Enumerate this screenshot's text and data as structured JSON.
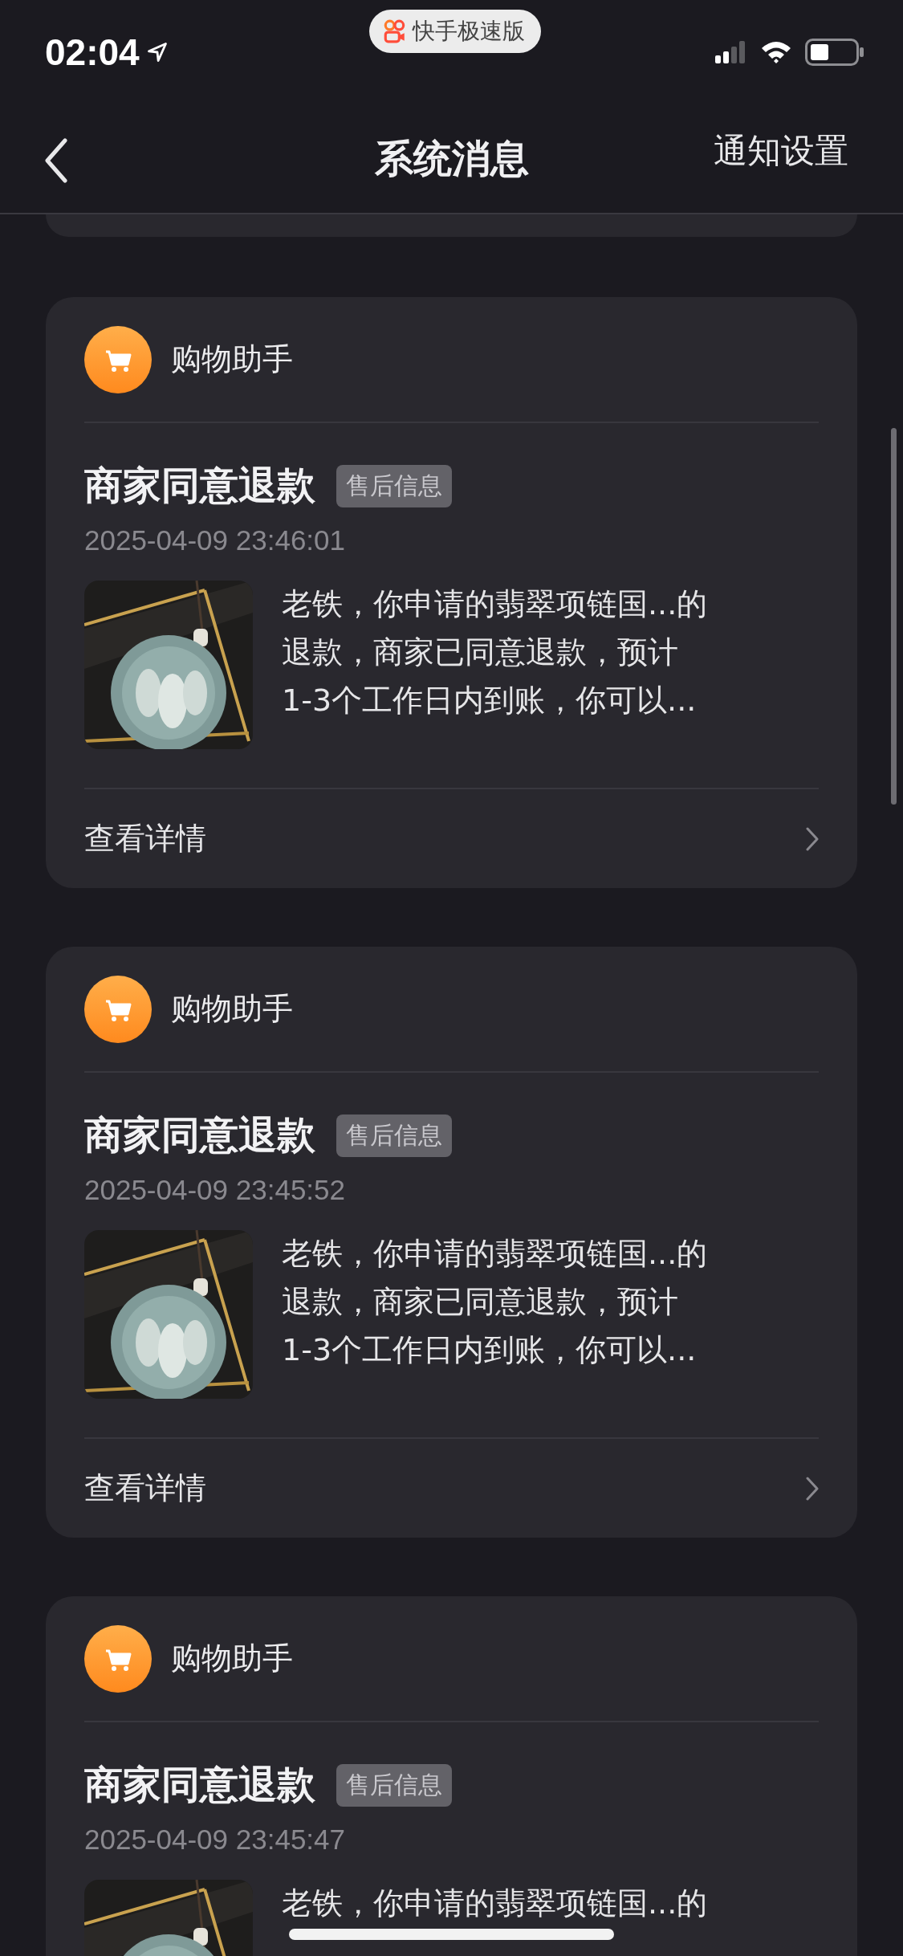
{
  "status_bar": {
    "time": "02:04",
    "app_pill": "快手极速版"
  },
  "nav": {
    "title": "系统消息",
    "action": "通知设置"
  },
  "messages": [
    {
      "sender": "购物助手",
      "title": "商家同意退款",
      "tag": "售后信息",
      "time": "2025-04-09 23:46:01",
      "lines": [
        "老铁，你申请的翡翠项链国...的",
        "退款，商家已同意退款，预计",
        "1-3个工作日内到账，你可以..."
      ],
      "footer": "查看详情"
    },
    {
      "sender": "购物助手",
      "title": "商家同意退款",
      "tag": "售后信息",
      "time": "2025-04-09 23:45:52",
      "lines": [
        "老铁，你申请的翡翠项链国...的",
        "退款，商家已同意退款，预计",
        "1-3个工作日内到账，你可以..."
      ],
      "footer": "查看详情"
    },
    {
      "sender": "购物助手",
      "title": "商家同意退款",
      "tag": "售后信息",
      "time": "2025-04-09 23:45:47",
      "lines": [
        "老铁，你申请的翡翠项链国...的"
      ]
    }
  ]
}
